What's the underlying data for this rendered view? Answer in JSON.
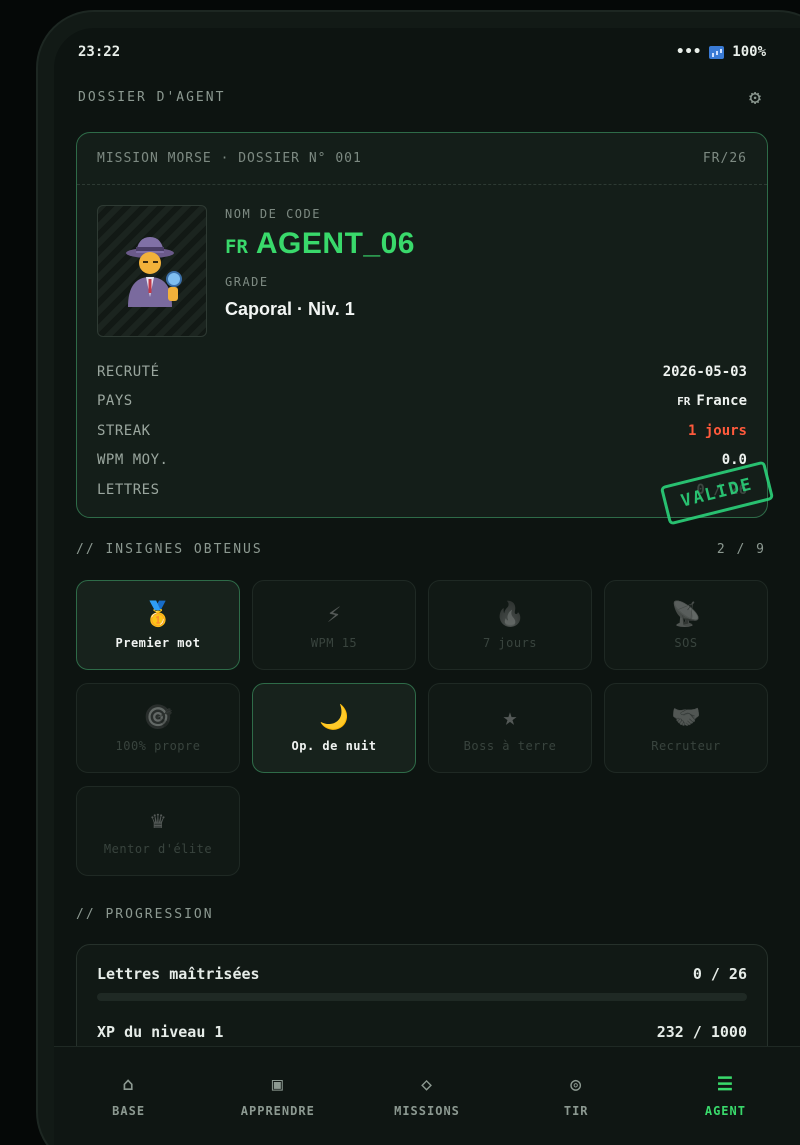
{
  "status": {
    "time": "23:22",
    "battery": "100%",
    "dots": "•••"
  },
  "header": {
    "title": "DOSSIER D'AGENT",
    "settings_icon": "gear-icon"
  },
  "dossier": {
    "mission": "MISSION MORSE · DOSSIER N° 001",
    "ref": "FR/26",
    "codename_label": "NOM DE CODE",
    "flag": "FR",
    "codename": "AGENT_06",
    "grade_label": "GRADE",
    "grade": "Caporal · Niv. 1",
    "avatar_icon": "detective-icon",
    "stamp": "VALIDE",
    "stats": [
      {
        "key": "RECRUTÉ",
        "value": "2026-05-03"
      },
      {
        "key": "PAYS",
        "value": "France",
        "flag": "FR"
      },
      {
        "key": "STREAK",
        "value": "1 jours"
      },
      {
        "key": "WPM MOY.",
        "value": "0.0"
      },
      {
        "key": "LETTRES",
        "value": "0 / 26"
      }
    ]
  },
  "badges": {
    "title": "// INSIGNES OBTENUS",
    "count": "2 / 9",
    "items": [
      {
        "label": "Premier mot",
        "icon": "medal-icon",
        "earned": true
      },
      {
        "label": "WPM 15",
        "icon": "lightning-icon",
        "earned": false
      },
      {
        "label": "7 jours",
        "icon": "flame-icon",
        "earned": false
      },
      {
        "label": "SOS",
        "icon": "satellite-icon",
        "earned": false
      },
      {
        "label": "100% propre",
        "icon": "target-icon",
        "earned": false
      },
      {
        "label": "Op. de nuit",
        "icon": "moon-icon",
        "earned": true
      },
      {
        "label": "Boss à terre",
        "icon": "star-icon",
        "earned": false
      },
      {
        "label": "Recruteur",
        "icon": "handshake-icon",
        "earned": false
      },
      {
        "label": "Mentor d'élite",
        "icon": "crown-icon",
        "earned": false
      }
    ]
  },
  "progression": {
    "title": "// PROGRESSION",
    "letters": {
      "label": "Lettres maîtrisées",
      "value": "0 / 26",
      "fraction": 0
    },
    "xp": {
      "label": "XP du niveau 1",
      "value": "232 / 1000",
      "fraction": 0.232
    }
  },
  "nav": [
    {
      "label": "BASE",
      "icon": "home-icon",
      "active": false
    },
    {
      "label": "APPRENDRE",
      "icon": "learn-icon",
      "active": false
    },
    {
      "label": "MISSIONS",
      "icon": "diamond-icon",
      "active": false
    },
    {
      "label": "TIR",
      "icon": "target-icon",
      "active": false
    },
    {
      "label": "AGENT",
      "icon": "menu-icon",
      "active": true
    }
  ],
  "colors": {
    "accent": "#39d96b",
    "streak": "#ff5a3c",
    "background": "#0d1411"
  }
}
